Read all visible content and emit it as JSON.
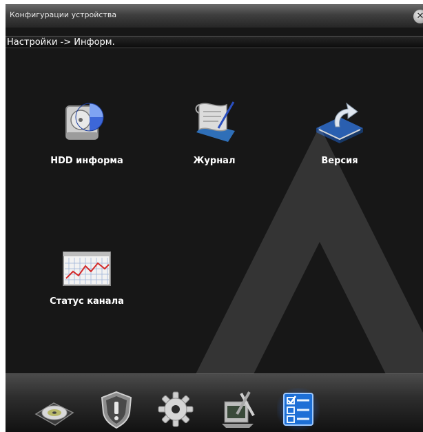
{
  "window": {
    "title": "Конфигурации устройства",
    "close_icon": "close-icon"
  },
  "breadcrumb": "Настройки -> Информ.",
  "tiles": [
    {
      "label": "HDD информа",
      "icon": "hdd-icon"
    },
    {
      "label": "Журнал",
      "icon": "log-icon"
    },
    {
      "label": "Версия",
      "icon": "version-icon"
    },
    {
      "label": "Статус канала",
      "icon": "channel-status-icon"
    }
  ],
  "dock": [
    {
      "icon": "disc-icon",
      "active": false
    },
    {
      "icon": "shield-icon",
      "active": false
    },
    {
      "icon": "gear-icon",
      "active": false
    },
    {
      "icon": "tools-icon",
      "active": false
    },
    {
      "icon": "info-list-icon",
      "active": true
    }
  ],
  "colors": {
    "background": "#171717",
    "text": "#ffffff",
    "active_glow": "#5aaaff"
  }
}
